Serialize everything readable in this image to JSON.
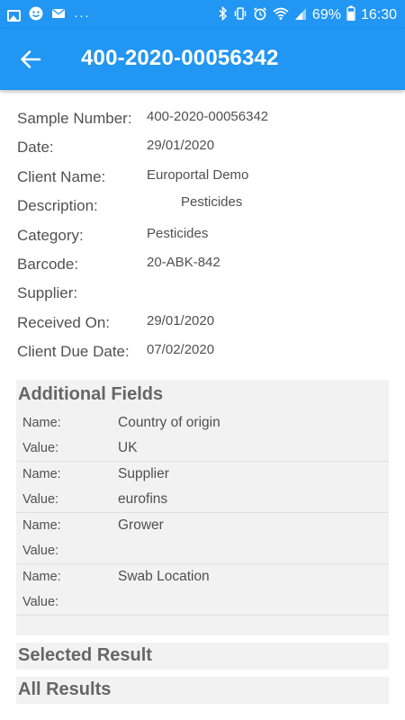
{
  "status_bar": {
    "battery": "69%",
    "time": "16:30",
    "left_icons": [
      "image-icon",
      "face-icon",
      "mail-icon",
      "more-dots-icon"
    ],
    "right_icons": [
      "bluetooth-icon",
      "vibrate-icon",
      "alarm-icon",
      "wifi-icon",
      "signal-icon",
      "battery-icon"
    ]
  },
  "app_bar": {
    "title": "400-2020-00056342",
    "back_icon": "arrow-back-icon"
  },
  "details": [
    {
      "label": "Sample Number:",
      "value": "400-2020-00056342"
    },
    {
      "label": "Date:",
      "value": "29/01/2020"
    },
    {
      "label": "Client Name:",
      "value": "Europortal Demo"
    },
    {
      "label": "Description:",
      "value": "Pesticides"
    },
    {
      "label": "Category:",
      "value": "Pesticides"
    },
    {
      "label": "Barcode:",
      "value": "20-ABK-842"
    },
    {
      "label": "Supplier:",
      "value": ""
    },
    {
      "label": "Received On:",
      "value": "29/01/2020"
    },
    {
      "label": "Client Due Date:",
      "value": "07/02/2020"
    }
  ],
  "additional_fields": {
    "title": "Additional Fields",
    "name_label": "Name:",
    "value_label": "Value:",
    "items": [
      {
        "name": "Country of origin",
        "value": "UK"
      },
      {
        "name": "Supplier",
        "value": "eurofins"
      },
      {
        "name": "Grower",
        "value": ""
      },
      {
        "name": "Swab Location",
        "value": ""
      }
    ]
  },
  "sections": {
    "selected_result": "Selected Result",
    "all_results": "All Results"
  },
  "colors": {
    "primary": "#2196f3",
    "section_bg": "#f2f2f2",
    "text": "#505050"
  }
}
